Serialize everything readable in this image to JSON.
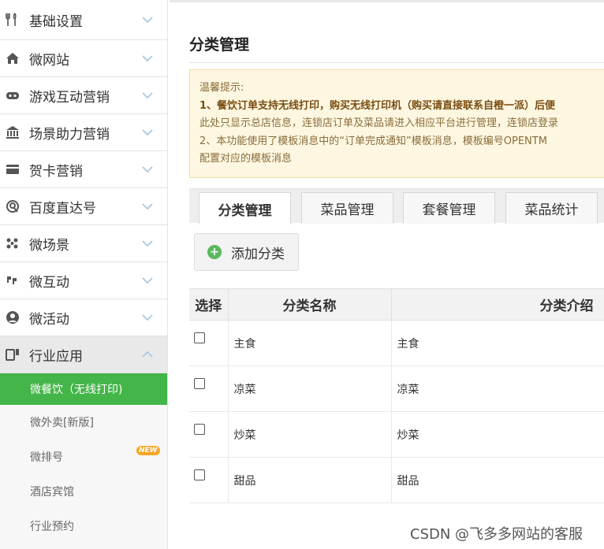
{
  "sidebar": {
    "items": [
      {
        "label": "基础设置",
        "icon": "utensils-icon"
      },
      {
        "label": "微网站",
        "icon": "home-icon"
      },
      {
        "label": "游戏互动营销",
        "icon": "gamepad-icon"
      },
      {
        "label": "场景助力营销",
        "icon": "bank-icon"
      },
      {
        "label": "贺卡营销",
        "icon": "card-icon"
      },
      {
        "label": "百度直达号",
        "icon": "baidu-icon"
      },
      {
        "label": "微场景",
        "icon": "scene-icon"
      },
      {
        "label": "微互动",
        "icon": "interact-icon"
      },
      {
        "label": "微活动",
        "icon": "activity-icon"
      },
      {
        "label": "行业应用",
        "icon": "industry-icon"
      }
    ],
    "sub_items": [
      {
        "label": "微餐饮（无线打印)"
      },
      {
        "label": "微外卖[新版]"
      },
      {
        "label": "微排号",
        "badge": "NEW"
      },
      {
        "label": "酒店宾馆"
      },
      {
        "label": "行业预约"
      }
    ]
  },
  "main": {
    "title": "分类管理",
    "tip": {
      "title": "温馨提示:",
      "line1": "1、餐饮订单支持无线打印，购买无线打印机（购买请直接联系自橙一派）后便",
      "line2": "此处只显示总店信息，连锁店订单及菜品请进入相应平台进行管理，连锁店登录",
      "line3": "2、本功能使用了模板消息中的“订单完成通知”模板消息，模板编号OPENTM",
      "line4": "配置对应的模板消息"
    },
    "tabs": [
      {
        "label": "分类管理",
        "active": true
      },
      {
        "label": "菜品管理"
      },
      {
        "label": "套餐管理"
      },
      {
        "label": "菜品统计"
      }
    ],
    "add_button": "添加分类",
    "table": {
      "headers": [
        "选择",
        "分类名称",
        "分类介绍"
      ],
      "rows": [
        {
          "name": "主食",
          "desc": "主食"
        },
        {
          "name": "凉菜",
          "desc": "凉菜"
        },
        {
          "name": "炒菜",
          "desc": "炒菜"
        },
        {
          "name": "甜品",
          "desc": "甜品"
        }
      ]
    }
  },
  "watermark": "CSDN @飞多多网站的客服",
  "colors": {
    "active_green": "#44b549",
    "tip_bg": "#fdf7e1",
    "tip_text": "#8a6d3b"
  }
}
